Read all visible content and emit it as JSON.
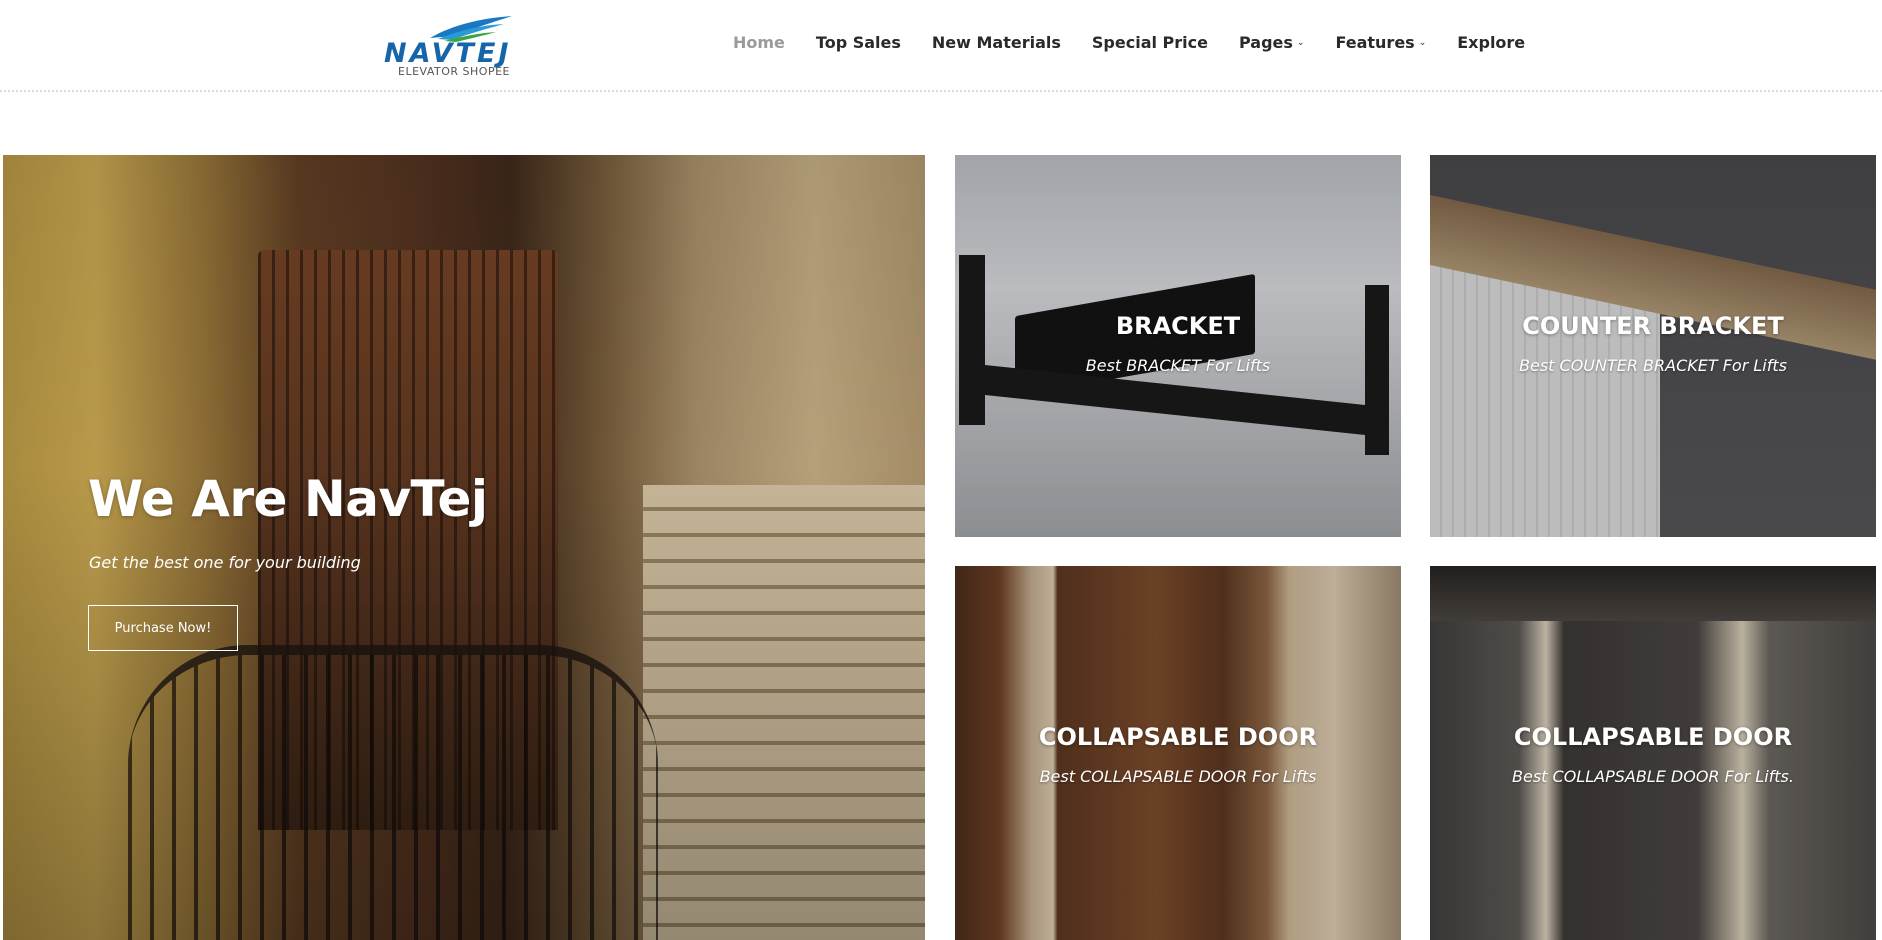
{
  "brand": {
    "name": "NAVTEJ",
    "tagline": "ELEVATOR SHOPEE",
    "colors": {
      "blue": "#1565a8",
      "green": "#3aa53f"
    }
  },
  "nav": {
    "items": [
      {
        "label": "Home",
        "active": true
      },
      {
        "label": "Top Sales"
      },
      {
        "label": "New Materials"
      },
      {
        "label": "Special Price"
      },
      {
        "label": "Pages",
        "dropdown": true
      },
      {
        "label": "Features",
        "dropdown": true
      },
      {
        "label": "Explore"
      }
    ],
    "caret_icon": "chevron-down-icon"
  },
  "hero": {
    "heading": "We Are NavTej",
    "subheading": "Get the best one for your building",
    "button_label": "Purchase Now!"
  },
  "tiles": [
    {
      "title": "BRACKET",
      "subtitle": "Best BRACKET For Lifts"
    },
    {
      "title": "COUNTER BRACKET",
      "subtitle": "Best COUNTER BRACKET For Lifts"
    },
    {
      "title": "COLLAPSABLE DOOR",
      "subtitle": "Best COLLAPSABLE DOOR For Lifts"
    },
    {
      "title": "COLLAPSABLE DOOR",
      "subtitle": "Best COLLAPSABLE DOOR For Lifts."
    }
  ]
}
